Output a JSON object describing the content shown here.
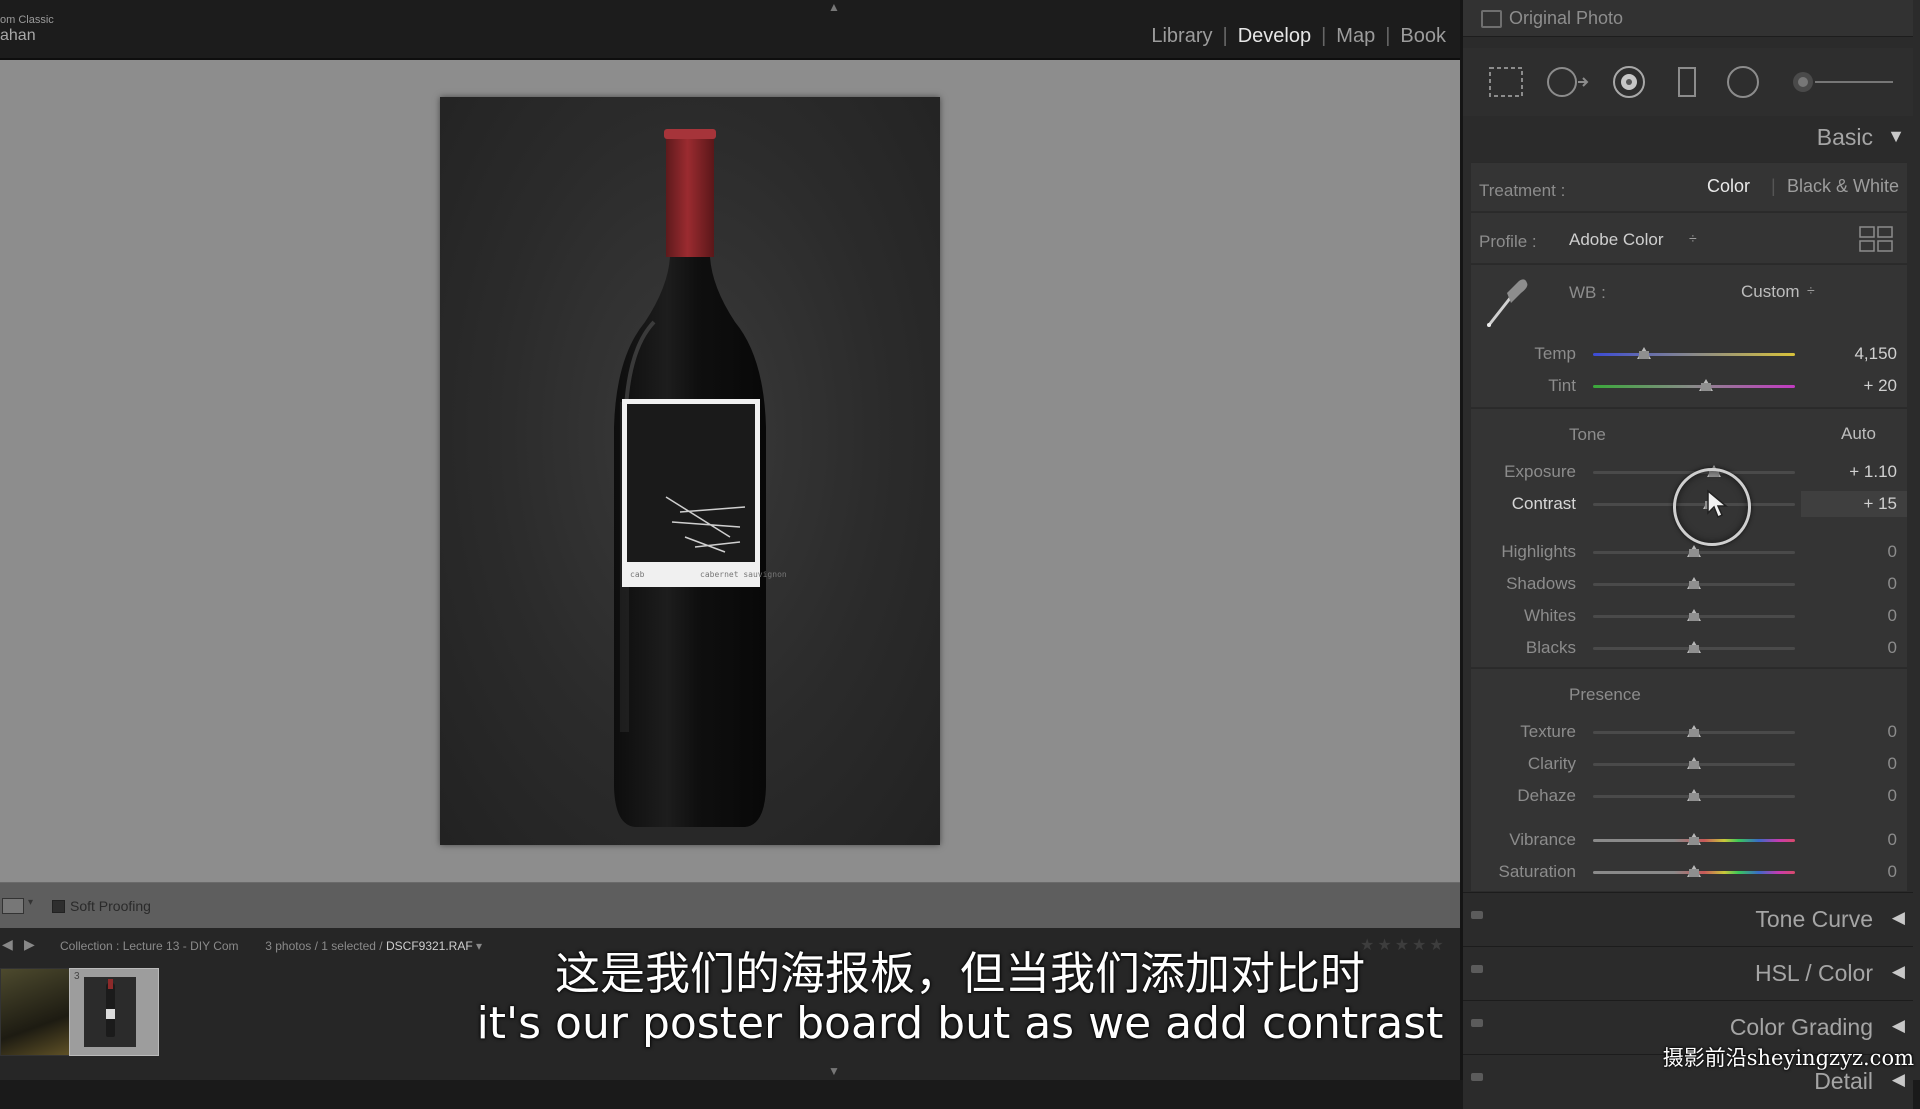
{
  "app": {
    "brand_line1": "om Classic",
    "brand_line2": "ahan",
    "modules": [
      "Library",
      "Develop",
      "Map",
      "Book"
    ],
    "active_module": "Develop"
  },
  "toolbar": {
    "soft_proofing": "Soft Proofing"
  },
  "filmstrip": {
    "collection": "Collection : Lecture 13 - DIY Com",
    "selection": "3 photos / 1 selected /",
    "file": "DSCF9321.RAF",
    "file_dropdown": "▾",
    "stars": "★★★★★",
    "thumb2_number": "3"
  },
  "panel": {
    "original_photo": "Original Photo",
    "basic_title": "Basic",
    "treatment_label": "Treatment :",
    "treatment_options": [
      "Color",
      "Black & White"
    ],
    "treatment_active": "Color",
    "profile_label": "Profile :",
    "profile_value": "Adobe Color",
    "profile_caret": "÷",
    "wb_label": "WB :",
    "wb_value": "Custom",
    "wb_caret": "÷",
    "tone_label": "Tone",
    "auto_label": "Auto",
    "presence_label": "Presence",
    "sliders": {
      "temp": {
        "label": "Temp",
        "value": "4,150",
        "pos": 0.25
      },
      "tint": {
        "label": "Tint",
        "value": "+ 20",
        "pos": 0.56
      },
      "exposure": {
        "label": "Exposure",
        "value": "+ 1.10",
        "pos": 0.6
      },
      "contrast": {
        "label": "Contrast",
        "value": "+ 15",
        "pos": 0.58
      },
      "highlights": {
        "label": "Highlights",
        "value": "0",
        "pos": 0.5
      },
      "shadows": {
        "label": "Shadows",
        "value": "0",
        "pos": 0.5
      },
      "whites": {
        "label": "Whites",
        "value": "0",
        "pos": 0.5
      },
      "blacks": {
        "label": "Blacks",
        "value": "0",
        "pos": 0.5
      },
      "texture": {
        "label": "Texture",
        "value": "0",
        "pos": 0.5
      },
      "clarity": {
        "label": "Clarity",
        "value": "0",
        "pos": 0.5
      },
      "dehaze": {
        "label": "Dehaze",
        "value": "0",
        "pos": 0.5
      },
      "vibrance": {
        "label": "Vibrance",
        "value": "0",
        "pos": 0.5
      },
      "saturation": {
        "label": "Saturation",
        "value": "0",
        "pos": 0.5
      }
    },
    "collapsed_panels": [
      "Tone Curve",
      "HSL / Color",
      "Color Grading",
      "Detail"
    ],
    "panel_arrow_collapsed": "◀",
    "panel_arrow_expanded": "▼",
    "icons": [
      "crop-overlay-icon",
      "spot-removal-icon",
      "red-eye-icon",
      "graduated-filter-icon",
      "radial-filter-icon",
      "adjustment-brush-icon"
    ]
  },
  "subtitles": {
    "chinese": "这是我们的海报板，但当我们添加对比时",
    "english": "it's our poster board but as we add contrast"
  },
  "watermark": "摄影前沿sheyingzyz.com",
  "colors": {
    "accent_text": "#e6e6e6",
    "panel_bg": "#343434",
    "bottle_cap": "#8d2a2a"
  }
}
